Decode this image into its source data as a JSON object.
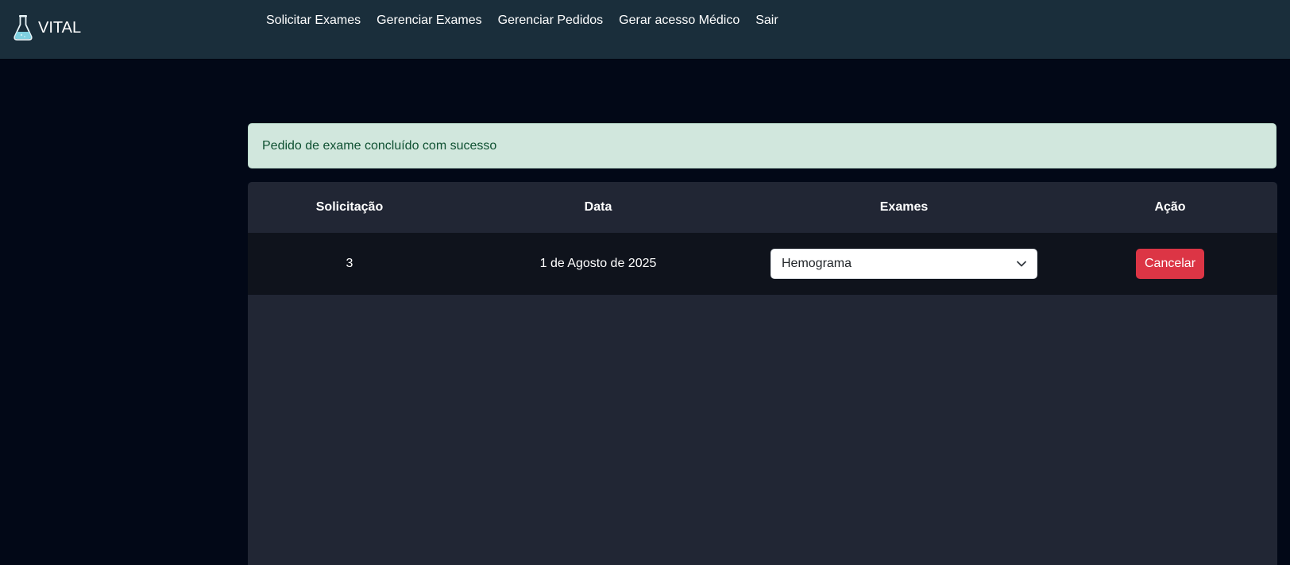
{
  "brand": {
    "name": "VITAL",
    "icon": "flask-icon"
  },
  "nav": {
    "items": [
      {
        "label": "Solicitar Exames"
      },
      {
        "label": "Gerenciar Exames"
      },
      {
        "label": "Gerenciar Pedidos"
      },
      {
        "label": "Gerar acesso Médico"
      },
      {
        "label": "Sair"
      }
    ]
  },
  "alert": {
    "message": "Pedido de exame concluído com sucesso"
  },
  "table": {
    "headers": [
      "Solicitação",
      "Data",
      "Exames",
      "Ação"
    ],
    "rows": [
      {
        "solicitacao": "3",
        "data": "1 de Agosto de 2025",
        "exames_selected": "Hemograma",
        "action_label": "Cancelar"
      }
    ]
  },
  "colors": {
    "navbar": "#1a2e3b",
    "background": "#020817",
    "alert_success_bg": "#d1e7dd",
    "danger": "#dc3545"
  }
}
